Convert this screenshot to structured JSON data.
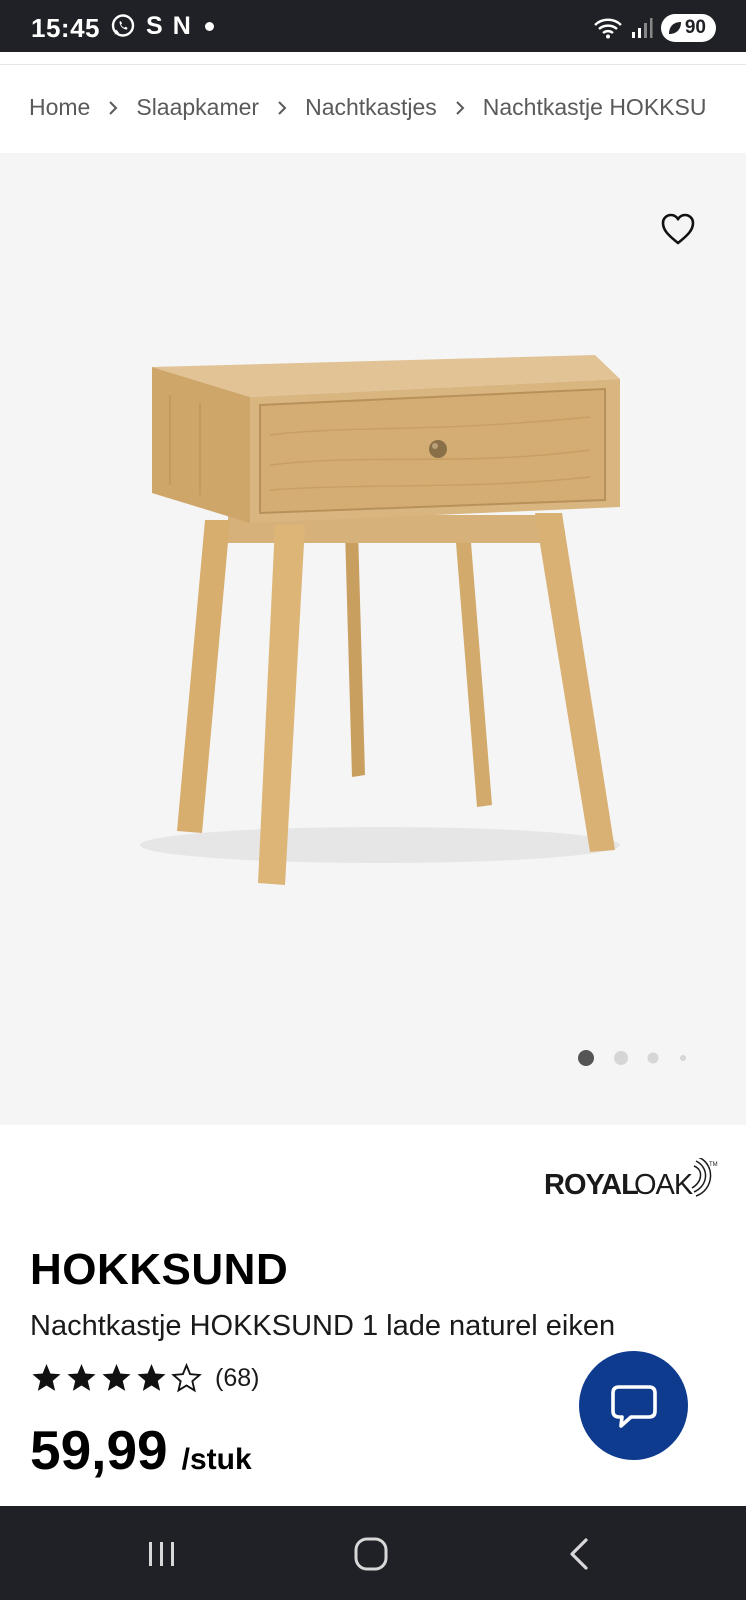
{
  "status_bar": {
    "time": "15:45",
    "app_icons": [
      "whatsapp-icon",
      "s-app-icon",
      "n-app-icon",
      "dot-icon"
    ],
    "battery": "90",
    "s_glyph": "S",
    "n_glyph": "N"
  },
  "breadcrumb": {
    "items": [
      "Home",
      "Slaapkamer",
      "Nachtkastjes",
      "Nachtkastje HOKKSU"
    ]
  },
  "gallery": {
    "image_count": 4,
    "active_index": 0
  },
  "product": {
    "brand_logo_text": "ROYALOAK",
    "name": "HOKKSUND",
    "description": "Nachtkastje HOKKSUND 1 lade naturel eiken",
    "rating": 4,
    "rating_max": 5,
    "review_count": "(68)",
    "price": "59,99",
    "unit": "/stuk"
  },
  "colors": {
    "status_bar": "#1f2126",
    "chat_button": "#0f3b8f",
    "gallery_bg": "#f5f5f5",
    "text": "#000000",
    "breadcrumb_text": "#5a5a5a"
  },
  "nav_bar": {
    "buttons": [
      "recent-apps-icon",
      "home-icon",
      "back-icon"
    ]
  }
}
